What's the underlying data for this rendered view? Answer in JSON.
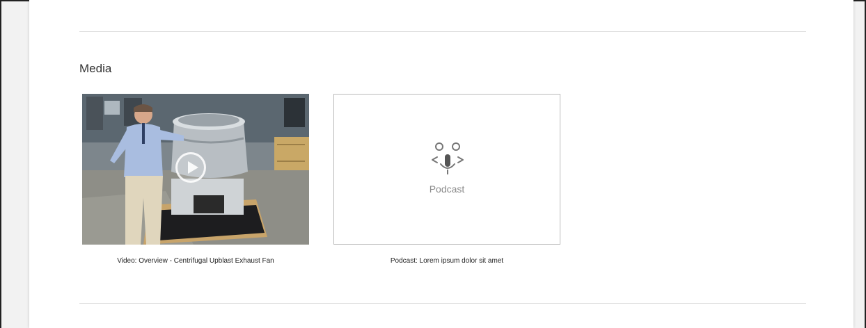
{
  "media": {
    "heading": "Media",
    "items": [
      {
        "type": "video",
        "caption": "Video: Overview - Centrifugal Upblast Exhaust Fan"
      },
      {
        "type": "podcast",
        "placeholder_label": "Podcast",
        "caption": "Podcast: Lorem ipsum dolor sit amet"
      }
    ]
  }
}
